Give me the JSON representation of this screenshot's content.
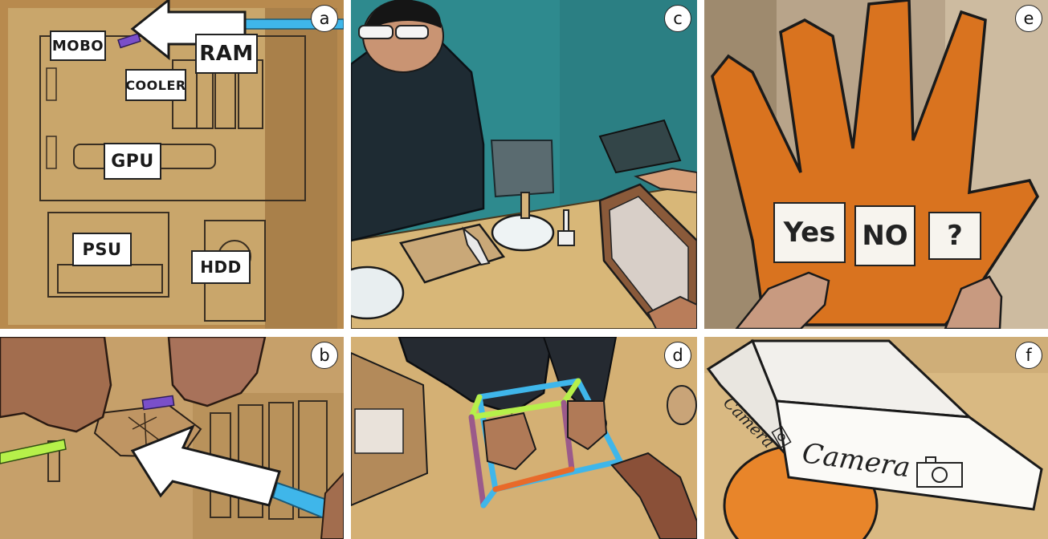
{
  "panels": {
    "a": {
      "letter": "a",
      "labels": {
        "mobo": "MOBO",
        "ram": "RAM",
        "cooler": "COOLER",
        "gpu": "GPU",
        "psu": "PSU",
        "hdd": "HDD"
      }
    },
    "b": {
      "letter": "b"
    },
    "c": {
      "letter": "c"
    },
    "d": {
      "letter": "d"
    },
    "e": {
      "letter": "e",
      "options": {
        "yes": "Yes",
        "no": "NO",
        "unknown": "?"
      }
    },
    "f": {
      "letter": "f",
      "camera_small": "Camera",
      "camera_large": "Camera"
    }
  },
  "colors": {
    "cardboard": "#c9a66b",
    "table": "#d8b778",
    "wall": "#2e8a8e",
    "hand_cutout": "#d9731f",
    "strip_blue": "#3fb6ea",
    "strip_green": "#b6f04a",
    "strip_purple": "#7a4fc9",
    "arrow_white": "#ffffff"
  }
}
